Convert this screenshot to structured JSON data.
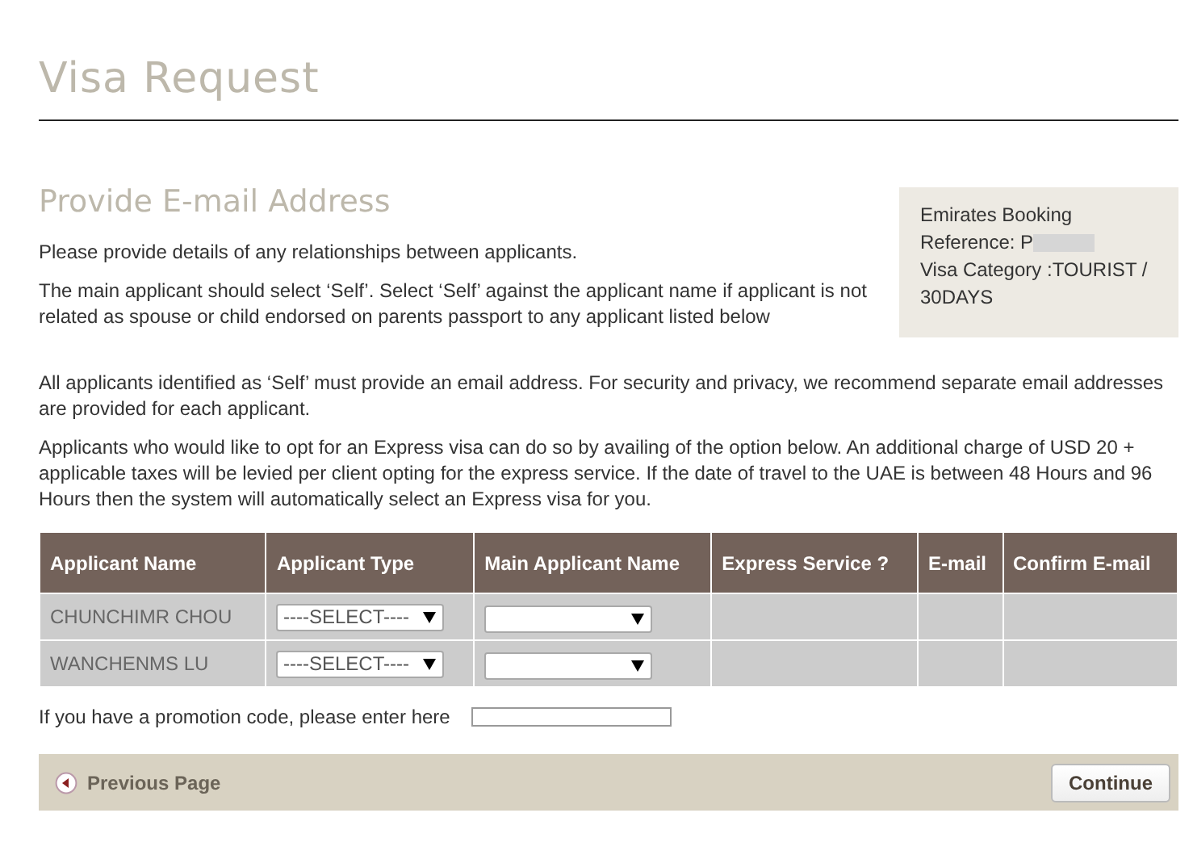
{
  "page_title": "Visa Request",
  "section_title": "Provide E-mail Address",
  "booking_info": {
    "lines": [
      "Emirates Booking",
      "Reference: P",
      "Visa Category :TOURIST /",
      "30DAYS"
    ],
    "reference_redacted": true
  },
  "paragraphs": [
    "Please provide details of any relationships between applicants.",
    "The main applicant should select ‘Self’. Select ‘Self’ against the applicant name if applicant is not related as spouse or child endorsed on parents passport to any applicant listed below",
    "All applicants identified as ‘Self’ must provide an email address. For security and privacy, we recommend separate email addresses are provided for each applicant.",
    "Applicants who would like to opt for an Express visa can do so by availing of the option below. An additional charge of USD 20 + applicable taxes will be levied per client opting for the express service. If the date of travel to the UAE is between 48 Hours and 96 Hours then the system will automatically select an Express visa for you."
  ],
  "table": {
    "columns": [
      "Applicant Name",
      "Applicant Type",
      "Main Applicant Name",
      "Express Service ?",
      "E-mail",
      "Confirm E-mail"
    ],
    "rows": [
      {
        "name": "CHUNCHIMR CHOU",
        "applicant_type": "----SELECT----"
      },
      {
        "name": "WANCHENMS LU",
        "applicant_type": "----SELECT----"
      }
    ]
  },
  "promotion": {
    "label": "If you have a promotion code, please enter here"
  },
  "footer": {
    "previous": "Previous Page",
    "continue": "Continue"
  }
}
